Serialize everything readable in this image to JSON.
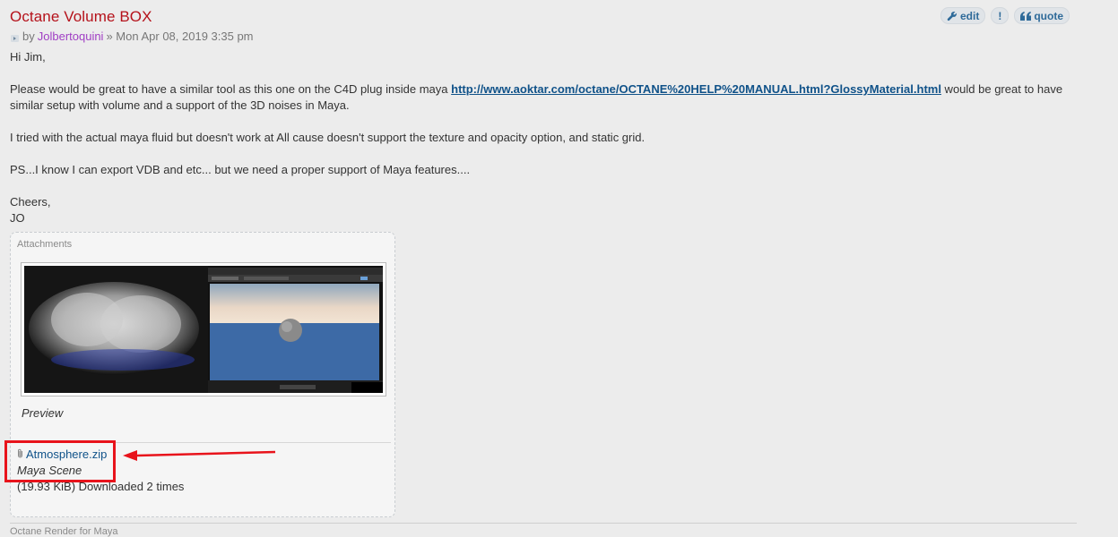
{
  "post": {
    "title": "Octane Volume BOX",
    "author_prefix": "by",
    "author": "Jolbertoquini",
    "date": "» Mon Apr 08, 2019 3:35 pm",
    "buttons": {
      "edit": "edit",
      "report": "!",
      "quote": "quote"
    },
    "body": {
      "greeting": "Hi Jim,",
      "p1_before": "Please would be great to have a similar tool as this one on the C4D plug inside maya ",
      "p1_link": "http://www.aoktar.com/octane/OCTANE%20HELP%20MANUAL.html?GlossyMaterial.html",
      "p1_after": " would be great to have similar setup with volume and a support of the 3D noises in Maya.",
      "p2": "I tried with the actual maya fluid but doesn't work at All cause doesn't support the texture and opacity option, and static grid.",
      "p3": "PS...I know I can export VDB and etc... but we need a proper support of Maya features....",
      "signoff": "Cheers,",
      "signature": "JO"
    },
    "attachments": {
      "title": "Attachments",
      "image_caption": "Preview",
      "file_name": "Atmosphere.zip",
      "file_description": "Maya Scene",
      "file_meta": "(19.93 KiB) Downloaded 2 times"
    }
  },
  "footer": {
    "partial_text": "Octane Render for Maya"
  },
  "colors": {
    "title": "#b5121b",
    "link": "#105289",
    "username": "#a03ec4",
    "annotation": "#e8131b"
  }
}
